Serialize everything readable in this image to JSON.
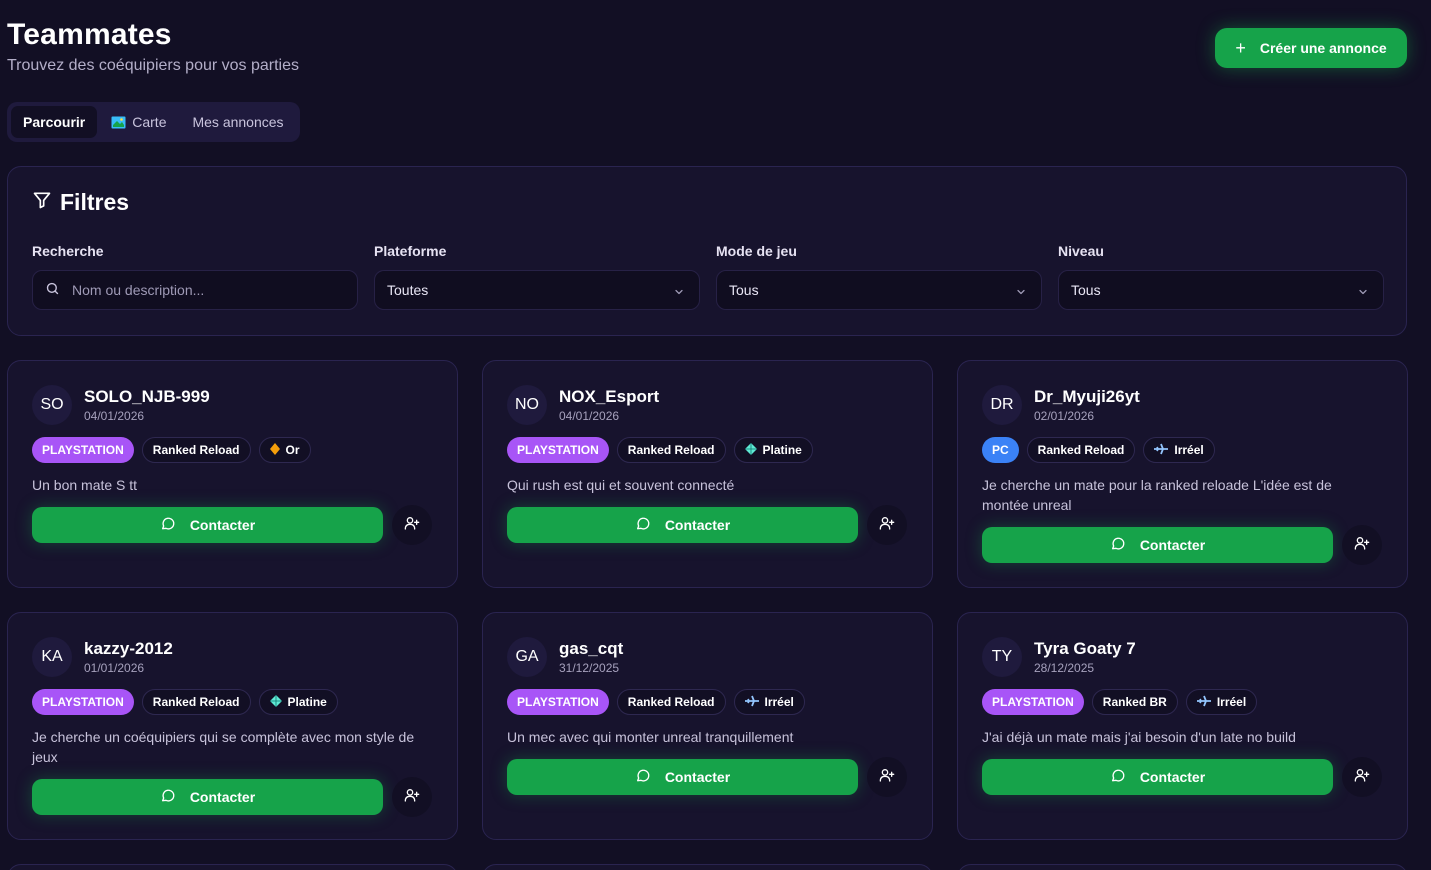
{
  "header": {
    "title": "Teammates",
    "subtitle": "Trouvez des coéquipiers pour vos parties",
    "create_button": "Créer une annonce"
  },
  "tabs": [
    {
      "label": "Parcourir",
      "active": true,
      "icon": ""
    },
    {
      "label": "Carte",
      "active": false,
      "icon": "map-icon"
    },
    {
      "label": "Mes annonces",
      "active": false,
      "icon": ""
    }
  ],
  "filters": {
    "title": "Filtres",
    "search": {
      "label": "Recherche",
      "placeholder": "Nom ou description...",
      "value": ""
    },
    "platform": {
      "label": "Plateforme",
      "value": "Toutes"
    },
    "mode": {
      "label": "Mode de jeu",
      "value": "Tous"
    },
    "level": {
      "label": "Niveau",
      "value": "Tous"
    }
  },
  "contact_label": "Contacter",
  "colors": {
    "background": "#120f24",
    "card": "#17132d",
    "accent_green": "#16a34a",
    "playstation_badge": "#a855f7",
    "pc_badge": "#3b82f6",
    "gold": "#f59e0b",
    "platine": "#5eead4",
    "irreel": "#93c5fd"
  },
  "cards": [
    {
      "initials": "SO",
      "username": "SOLO_NJB-999",
      "date": "04/01/2026",
      "platform": "PLAYSTATION",
      "mode": "Ranked Reload",
      "rank": "Or",
      "rank_icon": "gold-diamond-icon",
      "description": "Un bon mate S tt"
    },
    {
      "initials": "NO",
      "username": "NOX_Esport",
      "date": "04/01/2026",
      "platform": "PLAYSTATION",
      "mode": "Ranked Reload",
      "rank": "Platine",
      "rank_icon": "platine-diamond-icon",
      "description": "Qui rush est qui et souvent connecté"
    },
    {
      "initials": "DR",
      "username": "Dr_Myuji26yt",
      "date": "02/01/2026",
      "platform": "PC",
      "mode": "Ranked Reload",
      "rank": "Irréel",
      "rank_icon": "irreel-plane-icon",
      "description": "Je cherche un mate pour la ranked reloade L'idée est de montée unreal"
    },
    {
      "initials": "KA",
      "username": "kazzy-2012",
      "date": "01/01/2026",
      "platform": "PLAYSTATION",
      "mode": "Ranked Reload",
      "rank": "Platine",
      "rank_icon": "platine-diamond-icon",
      "description": "Je cherche un coéquipiers qui se complète avec mon style de jeux"
    },
    {
      "initials": "GA",
      "username": "gas_cqt",
      "date": "31/12/2025",
      "platform": "PLAYSTATION",
      "mode": "Ranked Reload",
      "rank": "Irréel",
      "rank_icon": "irreel-plane-icon",
      "description": "Un mec avec qui monter unreal tranquillement"
    },
    {
      "initials": "TY",
      "username": "Tyra Goaty 7",
      "date": "28/12/2025",
      "platform": "PLAYSTATION",
      "mode": "Ranked BR",
      "rank": "Irréel",
      "rank_icon": "irreel-plane-icon",
      "description": "J'ai déjà un mate mais j'ai besoin d'un late no build"
    }
  ]
}
